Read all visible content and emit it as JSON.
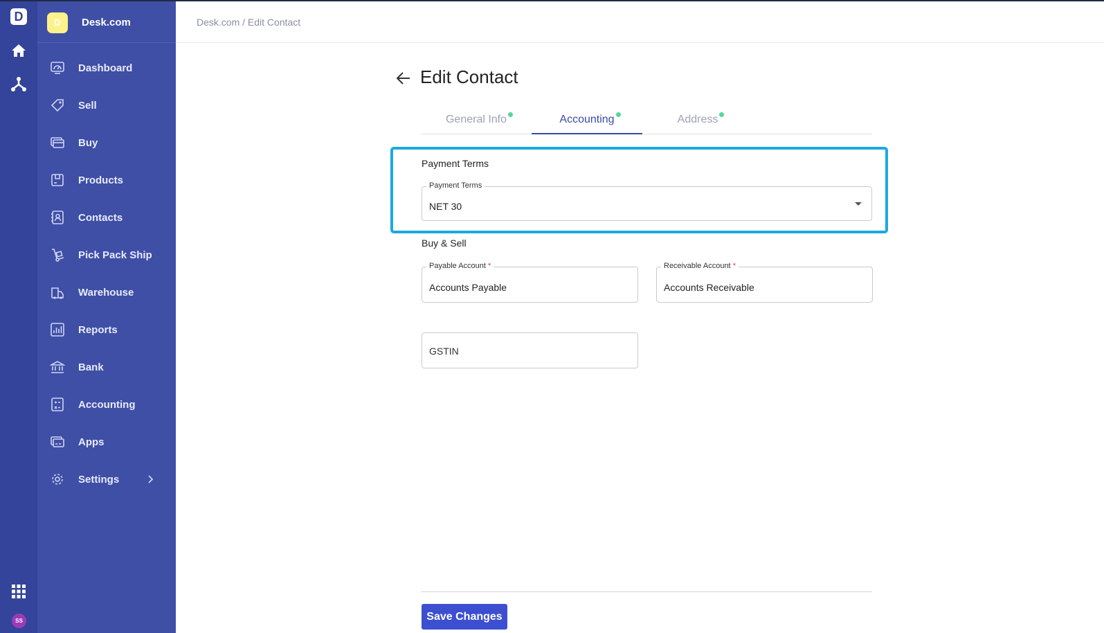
{
  "rail": {
    "logo_letter": "D",
    "avatar_initials": "SS"
  },
  "sidebar": {
    "brand_initial": "D",
    "brand_name": "Desk.com",
    "items": [
      {
        "label": "Dashboard",
        "icon": "dashboard-icon"
      },
      {
        "label": "Sell",
        "icon": "sell-tag-icon"
      },
      {
        "label": "Buy",
        "icon": "buy-card-icon"
      },
      {
        "label": "Products",
        "icon": "products-box-icon"
      },
      {
        "label": "Contacts",
        "icon": "contacts-icon"
      },
      {
        "label": "Pick Pack Ship",
        "icon": "hand-truck-icon"
      },
      {
        "label": "Warehouse",
        "icon": "warehouse-icon"
      },
      {
        "label": "Reports",
        "icon": "reports-icon"
      },
      {
        "label": "Bank",
        "icon": "bank-icon"
      },
      {
        "label": "Accounting",
        "icon": "accounting-icon"
      },
      {
        "label": "Apps",
        "icon": "apps-icon"
      },
      {
        "label": "Settings",
        "icon": "gear-icon"
      }
    ]
  },
  "header": {
    "breadcrumb": "Desk.com / Edit Contact"
  },
  "page": {
    "title": "Edit Contact",
    "tabs": [
      {
        "label": "General Info",
        "active": false
      },
      {
        "label": "Accounting",
        "active": true
      },
      {
        "label": "Address",
        "active": false
      }
    ]
  },
  "payment_terms": {
    "section_title": "Payment Terms",
    "field_label": "Payment Terms",
    "value": "NET 30"
  },
  "buy_sell": {
    "section_title": "Buy & Sell",
    "payable_label": "Payable Account",
    "payable_value": "Accounts Payable",
    "receivable_label": "Receivable Account",
    "receivable_value": "Accounts Receivable",
    "required_mark": "*",
    "gstin_placeholder": "GSTIN"
  },
  "footer": {
    "save_label": "Save Changes"
  },
  "colors": {
    "rail": "#34449a",
    "sidebar": "#3f4fa6",
    "accent": "#3a4ba3",
    "button": "#3c4fd0",
    "highlight": "#1da9df",
    "tab_dot": "#53d79a"
  }
}
